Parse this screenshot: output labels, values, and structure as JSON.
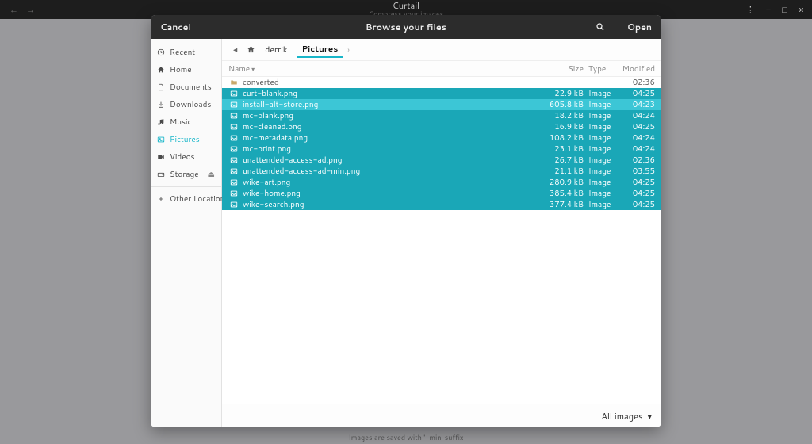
{
  "app": {
    "title": "Curtail",
    "subtitle": "Compress your images"
  },
  "window_controls": {
    "minimize": "−",
    "maximize": "□",
    "close": "×",
    "menu": "⋮"
  },
  "dialog": {
    "cancel": "Cancel",
    "title": "Browse your files",
    "open": "Open",
    "filter": "All images"
  },
  "sidebar": {
    "items": [
      {
        "icon": "clock",
        "label": "Recent"
      },
      {
        "icon": "home",
        "label": "Home"
      },
      {
        "icon": "doc",
        "label": "Documents"
      },
      {
        "icon": "down",
        "label": "Downloads"
      },
      {
        "icon": "music",
        "label": "Music"
      },
      {
        "icon": "picture",
        "label": "Pictures",
        "active": true
      },
      {
        "icon": "video",
        "label": "Videos"
      },
      {
        "icon": "disk",
        "label": "Storage",
        "eject": true
      }
    ],
    "other": "Other Locations"
  },
  "path": {
    "home": "derrik",
    "current": "Pictures"
  },
  "columns": {
    "name": "Name",
    "size": "Size",
    "type": "Type",
    "modified": "Modified"
  },
  "files": [
    {
      "kind": "folder",
      "name": "converted",
      "size": "",
      "type": "",
      "modified": "02:36"
    },
    {
      "kind": "sel",
      "name": "curt-blank.png",
      "size": "22.9 kB",
      "type": "Image",
      "modified": "04:25"
    },
    {
      "kind": "cursor",
      "name": "install-alt-store.png",
      "size": "605.8 kB",
      "type": "Image",
      "modified": "04:23"
    },
    {
      "kind": "sel",
      "name": "mc-blank.png",
      "size": "18.2 kB",
      "type": "Image",
      "modified": "04:24"
    },
    {
      "kind": "sel",
      "name": "mc-cleaned.png",
      "size": "16.9 kB",
      "type": "Image",
      "modified": "04:25"
    },
    {
      "kind": "sel",
      "name": "mc-metadata.png",
      "size": "108.2 kB",
      "type": "Image",
      "modified": "04:24"
    },
    {
      "kind": "sel",
      "name": "mc-print.png",
      "size": "23.1 kB",
      "type": "Image",
      "modified": "04:24"
    },
    {
      "kind": "sel",
      "name": "unattended-access-ad.png",
      "size": "26.7 kB",
      "type": "Image",
      "modified": "02:36"
    },
    {
      "kind": "sel",
      "name": "unattended-access-ad-min.png",
      "size": "21.1 kB",
      "type": "Image",
      "modified": "03:55"
    },
    {
      "kind": "sel",
      "name": "wike-art.png",
      "size": "280.9 kB",
      "type": "Image",
      "modified": "04:25"
    },
    {
      "kind": "sel",
      "name": "wike-home.png",
      "size": "385.4 kB",
      "type": "Image",
      "modified": "04:25"
    },
    {
      "kind": "sel",
      "name": "wike-search.png",
      "size": "377.4 kB",
      "type": "Image",
      "modified": "04:25"
    }
  ],
  "hint": "Images are saved with '-min' suffix"
}
